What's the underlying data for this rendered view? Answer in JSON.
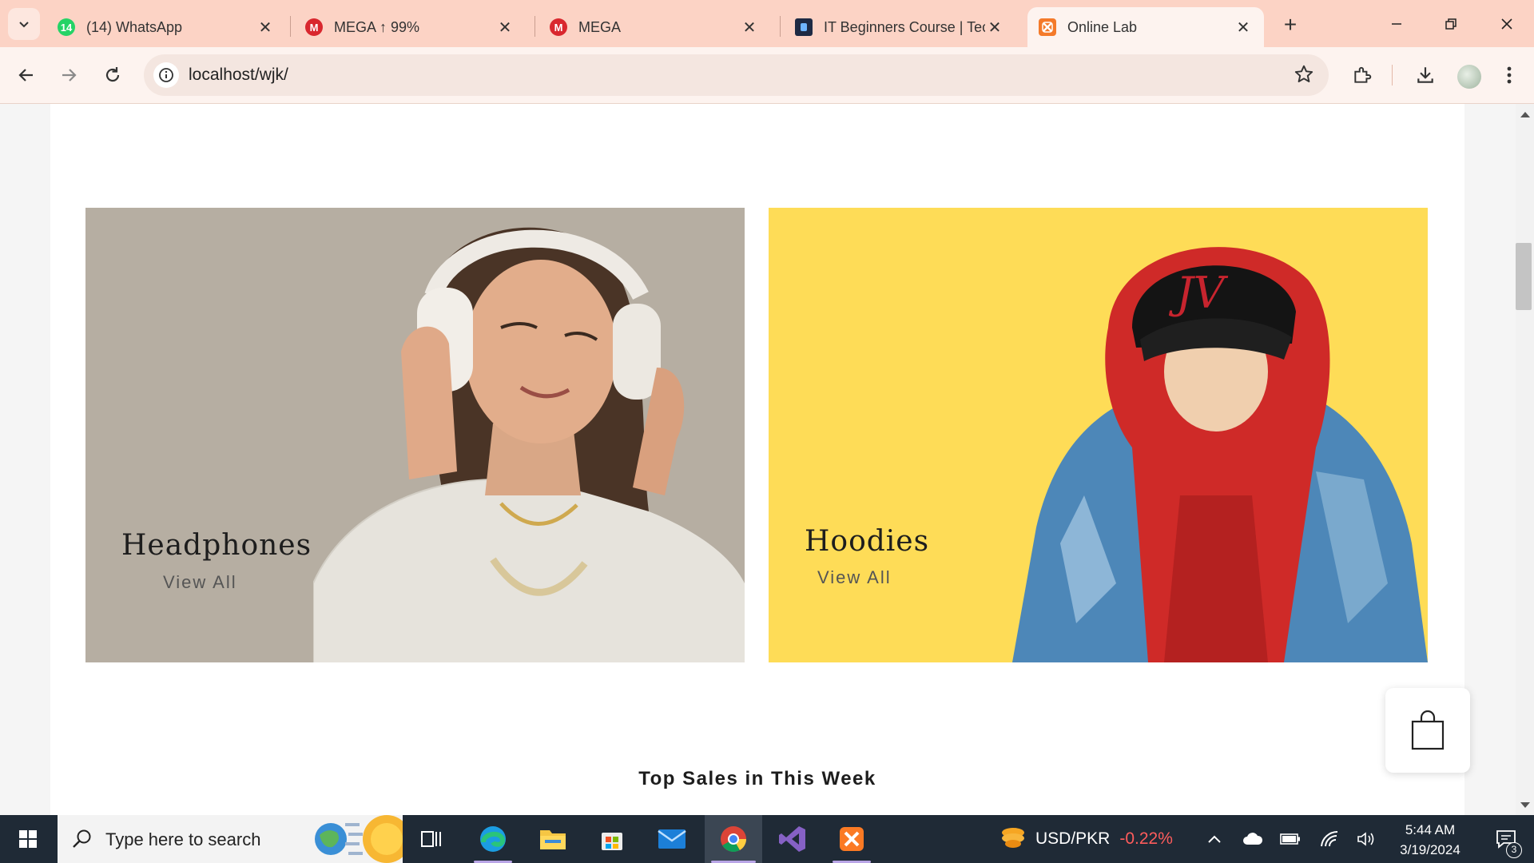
{
  "browser": {
    "tabs": [
      {
        "title": "(14) WhatsApp",
        "favicon": "whatsapp-icon",
        "badge": "14",
        "active": false
      },
      {
        "title": "MEGA ↑ 99%",
        "favicon": "mega-icon",
        "badge": "M",
        "active": false
      },
      {
        "title": "MEGA",
        "favicon": "mega-icon",
        "badge": "M",
        "active": false
      },
      {
        "title": "IT Beginners Course | Tec",
        "favicon": "course-icon",
        "badge": "",
        "active": false
      },
      {
        "title": "Online Lab",
        "favicon": "xampp-icon",
        "badge": "",
        "active": true
      }
    ],
    "url": "localhost/wjk/"
  },
  "page": {
    "banners": [
      {
        "title": "Headphones",
        "link": "View All",
        "bg": "#b6aea2"
      },
      {
        "title": "Hoodies",
        "link": "View All",
        "bg": "#fedc57"
      }
    ],
    "section_title": "Top Sales in This Week"
  },
  "taskbar": {
    "search_placeholder": "Type here to search",
    "ticker": {
      "label": "USD/PKR",
      "change": "-0.22%"
    },
    "time": "5:44 AM",
    "date": "3/19/2024",
    "notification_count": "3"
  },
  "colors": {
    "whatsapp": "#25d366",
    "mega": "#d9272e",
    "accent_yellow": "#fedc57"
  }
}
